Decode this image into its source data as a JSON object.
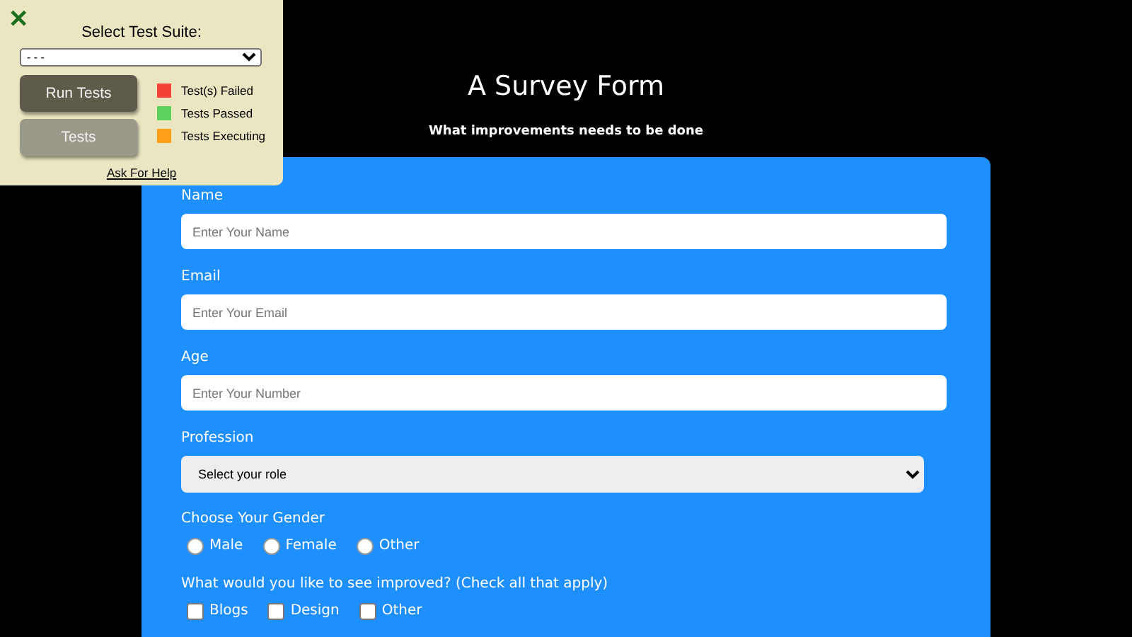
{
  "test_panel": {
    "close": "✕",
    "suite_label": "Select Test Suite:",
    "suite_value": "- - -",
    "buttons": [
      {
        "label": "Run Tests",
        "kind": "primary"
      },
      {
        "label": "Tests",
        "kind": "secondary"
      }
    ],
    "legend": [
      {
        "label": "Test(s) Failed",
        "color": "#f44336"
      },
      {
        "label": "Tests Passed",
        "color": "#5bd25b"
      },
      {
        "label": "Tests Executing",
        "color": "#ff9f1a"
      }
    ],
    "help_link": "Ask For Help"
  },
  "title": "A Survey Form",
  "subtitle": "What improvements needs to be done",
  "fields": [
    {
      "label": "Name",
      "placeholder": "Enter Your Name"
    },
    {
      "label": "Email",
      "placeholder": "Enter Your Email"
    },
    {
      "label": "Age",
      "placeholder": "Enter Your Number"
    }
  ],
  "profession": {
    "label": "Profession",
    "value": "Select your role"
  },
  "gender": {
    "label": "Choose Your Gender",
    "options": [
      {
        "label": "Male",
        "selected": false
      },
      {
        "label": "Female",
        "selected": false
      },
      {
        "label": "Other",
        "selected": false
      }
    ]
  },
  "improvements": {
    "label": "What would you like to see improved? (Check all that apply)",
    "options": [
      {
        "label": "Blogs",
        "checked": false
      },
      {
        "label": "Design",
        "checked": false
      },
      {
        "label": "Other",
        "checked": false
      }
    ]
  }
}
